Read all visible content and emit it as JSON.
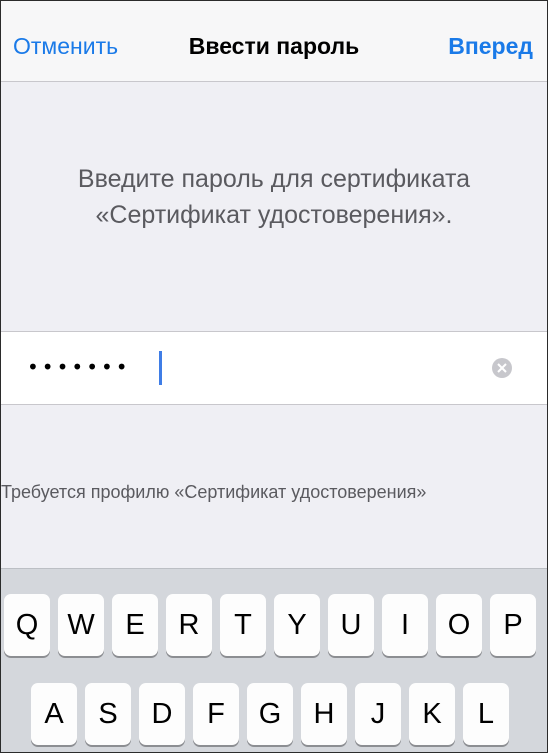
{
  "navbar": {
    "cancel_label": "Отменить",
    "title": "Ввести пароль",
    "next_label": "Вперед"
  },
  "prompt": {
    "line1": "Введите пароль для сертификата",
    "line2": "«Сертификат удостоверения»."
  },
  "password_field": {
    "value": "•••••••",
    "clear_icon": "clear-circle-icon"
  },
  "footer": {
    "text": "Требуется профилю «Сертификат удостоверения»"
  },
  "keyboard": {
    "row1": [
      "Q",
      "W",
      "E",
      "R",
      "T",
      "Y",
      "U",
      "I",
      "O",
      "P"
    ],
    "row2": [
      "A",
      "S",
      "D",
      "F",
      "G",
      "H",
      "J",
      "K",
      "L"
    ]
  },
  "colors": {
    "accent": "#1a7ae8",
    "cursor": "#3f7de6",
    "background": "#efeff4"
  }
}
